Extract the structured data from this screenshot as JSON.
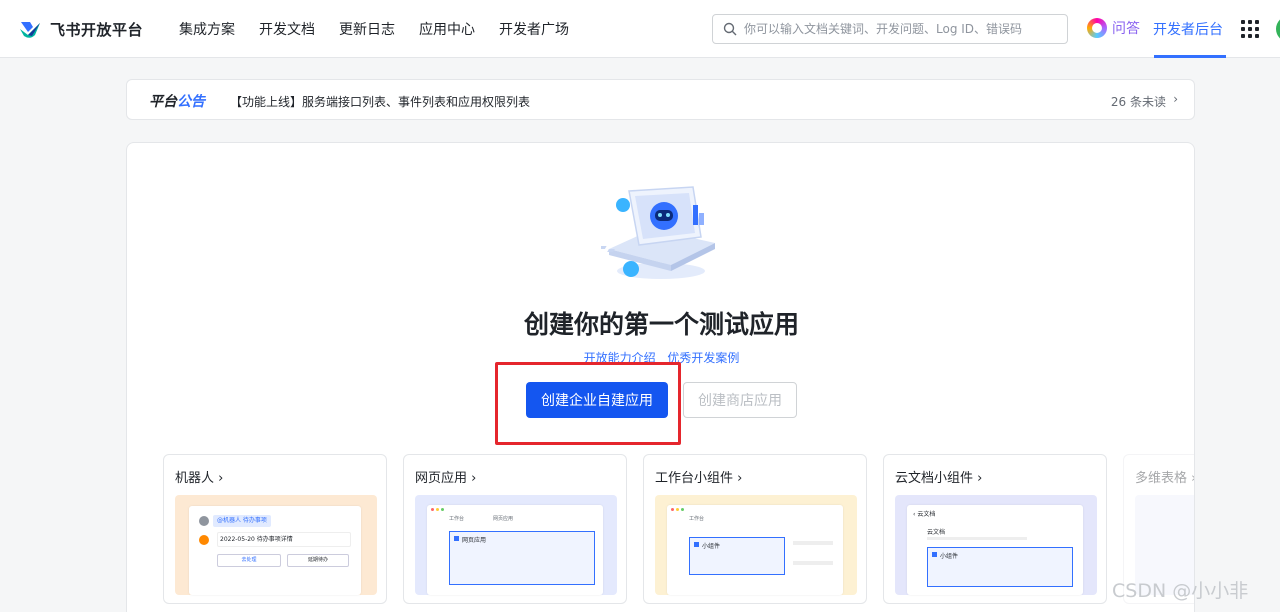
{
  "header": {
    "logo_text": "飞书开放平台",
    "nav": [
      "集成方案",
      "开发文档",
      "更新日志",
      "应用中心",
      "开发者广场"
    ],
    "search_placeholder": "你可以输入文档关键词、开发问题、Log ID、错误码",
    "ask_label": "问答",
    "console_label": "开发者后台"
  },
  "announcement": {
    "title_part1": "平台",
    "title_part2": "公告",
    "text": "【功能上线】服务端接口列表、事件列表和应用权限列表",
    "unread": "26 条未读"
  },
  "main": {
    "title": "创建你的第一个测试应用",
    "link_capabilities": "开放能力介绍",
    "link_cases": "优秀开发案例",
    "primary_button": "创建企业自建应用",
    "secondary_button": "创建商店应用"
  },
  "templates": [
    {
      "title": "机器人",
      "bg": "#fde9d3",
      "label": "@机器人 待办事项",
      "date_line": "2022-05-20 待办事项详情",
      "btn1": "去处理",
      "btn2": "延期待办"
    },
    {
      "title": "网页应用",
      "bg": "#e4e9fd",
      "tab1": "工作台",
      "tab2": "网页应用",
      "label": "网页应用"
    },
    {
      "title": "工作台小组件",
      "bg": "#fdf1d3",
      "tab1": "工作台",
      "label": "小组件"
    },
    {
      "title": "云文档小组件",
      "bg": "#e4e6fb",
      "doc": "云文档",
      "doc_title": "云文档",
      "label": "小组件"
    },
    {
      "title": "多维表格",
      "bg": "#eceefb"
    }
  ],
  "watermark": "CSDN @小小非",
  "colors": {
    "primary": "#1456f0",
    "link": "#3370ff",
    "highlight": "#e5262d"
  }
}
